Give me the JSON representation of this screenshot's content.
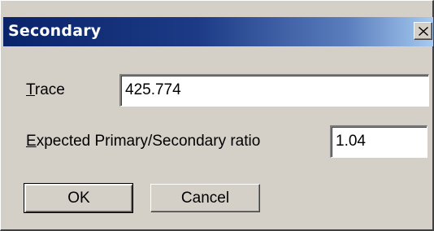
{
  "window": {
    "title": "Secondary",
    "close_icon": "close-icon"
  },
  "form": {
    "trace": {
      "label_mnemonic": "T",
      "label_rest": "race",
      "value": "425.774"
    },
    "ratio": {
      "label_mnemonic": "E",
      "label_rest": "xpected Primary/Secondary ratio",
      "value": "1.04"
    }
  },
  "buttons": {
    "ok_label": "OK",
    "cancel_label": "Cancel"
  },
  "colors": {
    "titlebar_start": "#0a246a",
    "titlebar_end": "#a6caf0",
    "dialog_face": "#d4d0c8"
  }
}
